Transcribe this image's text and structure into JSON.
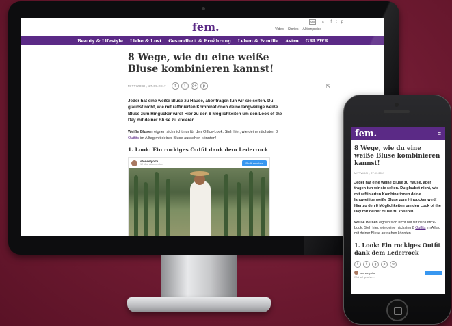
{
  "site": {
    "logo": "fem.",
    "top_links": [
      "Video",
      "Stories",
      "Aktionpreise"
    ],
    "subscribe": "Abo",
    "nav": [
      "Beauty & Lifestyle",
      "Liebe & Lust",
      "Gesundheit & Ernährung",
      "Leben & Familie",
      "Astro",
      "GRLPWR"
    ]
  },
  "article": {
    "title": "8 Wege, wie du eine weiße Bluse kombinieren kannst!",
    "date": "MITTWOCH, 27.09.2017",
    "share_icons": [
      "f",
      "t",
      "g+",
      "p"
    ],
    "lead": "Jeder hat eine weiße Bluse zu Hause, aber tragen tun wir sie selten. Du glaubst nicht, wie mit raffinierten Kombinationen deine langweilige weiße Bluse zum Hingucker wird! Hier zu den 8 Möglichkeiten um den Look of the Day mit deiner Bluse zu kreieren.",
    "para_bold": "Weiße Blusen",
    "para_rest": " eignen sich nicht nur für den Office-Look. Sieh hier, wie deine nächsten 8 ",
    "para_link": "Outfits",
    "para_end": " im Alltag mit deiner Bluse aussehen könnten!",
    "h2": "1. Look: Ein rockiges Outfit dank dem Lederrock",
    "insta_user": "stoneelyolta",
    "insta_sub": "12 Mio. Abonnenten",
    "insta_btn": "Profil ansehen"
  },
  "phone": {
    "logo": "fem.",
    "menu": "≡",
    "title": "8 Wege, wie du eine weiße Bluse kombinieren kannst!",
    "date": "MITTWOCH, 27.09.2017",
    "lead": "Jeder hat eine weiße Bluse zu Hause, aber tragen tun wir sie selten. Du glaubst nicht, wie mit raffinierten Kombinationen deine langweilige weiße Bluse zum Hingucker wird! Hier zu den 8 Möglichkeiten um den Look of the Day mit deiner Bluse zu kreieren.",
    "para_bold": "Weiße Blusen",
    "para_rest": " eignen sich nicht nur für den Office-Look. Sieh hier, wie deine nächsten 8 ",
    "para_link": "Outfits",
    "para_end": " im Alltag mit deiner Bluse aussehen könnten.",
    "h2": "1. Look: Ein rockiges Outfit dank dem Lederrock",
    "insta_user": "stoneelyolta",
    "footnote": "Wird auf gesehen..."
  },
  "colors": {
    "brand": "#5b2a86",
    "background": "#6e1a31"
  }
}
